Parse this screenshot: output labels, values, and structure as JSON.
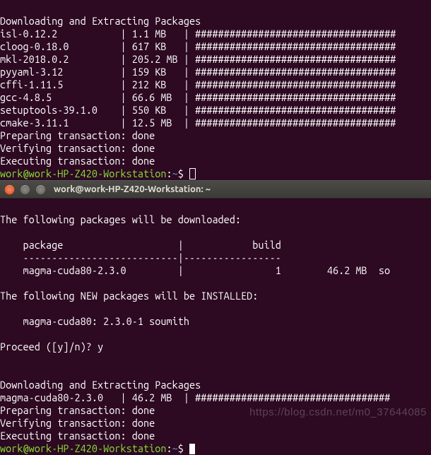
{
  "top_terminal": {
    "header": "Downloading and Extracting Packages",
    "packages": [
      {
        "name": "isl-0.12.2",
        "size": "1.1 MB",
        "bar": "###################################"
      },
      {
        "name": "cloog-0.18.0",
        "size": "617 KB",
        "bar": "###################################"
      },
      {
        "name": "mkl-2018.0.2",
        "size": "205.2 MB",
        "bar": "###################################"
      },
      {
        "name": "pyyaml-3.12",
        "size": "159 KB",
        "bar": "###################################"
      },
      {
        "name": "cffi-1.11.5",
        "size": "212 KB",
        "bar": "###################################"
      },
      {
        "name": "gcc-4.8.5",
        "size": "66.6 MB",
        "bar": "###################################"
      },
      {
        "name": "setuptools-39.1.0",
        "size": "550 KB",
        "bar": "###################################"
      },
      {
        "name": "cmake-3.11.1",
        "size": "12.5 MB",
        "bar": "###################################"
      }
    ],
    "steps": [
      "Preparing transaction: done",
      "Verifying transaction: done",
      "Executing transaction: done"
    ],
    "prompt": {
      "user": "work@work-HP-Z420-Workstation",
      "path": "~",
      "sep": ":",
      "end": "$ "
    }
  },
  "title_bar": {
    "title": "work@work-HP-Z420-Workstation: ~"
  },
  "bottom_terminal": {
    "intro": "The following packages will be downloaded:",
    "table_head": "    package                    |            build",
    "table_divider": "    ---------------------------|-----------------",
    "table_row": "    magma-cuda80-2.3.0         |                1        46.2 MB  so",
    "new_pkg_header": "The following NEW packages will be INSTALLED:",
    "new_pkg_line": "    magma-cuda80: 2.3.0-1 soumith",
    "proceed": "Proceed ([y]/n)? y",
    "download_header": "Downloading and Extracting Packages",
    "download_row": {
      "name": "magma-cuda80-2.3.0",
      "size": "46.2 MB",
      "bar": "##################################"
    },
    "steps": [
      "Preparing transaction: done",
      "Verifying transaction: done",
      "Executing transaction: done"
    ],
    "prompt": {
      "user": "work@work-HP-Z420-Workstation",
      "path": "~",
      "sep": ":",
      "end": "$ "
    }
  },
  "watermark": "https://blog.csdn.net/m0_37644085"
}
